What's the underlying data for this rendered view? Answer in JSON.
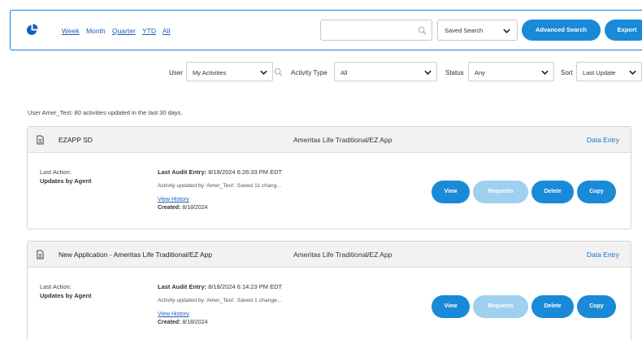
{
  "toolbar": {
    "periods": [
      "Week",
      "Month",
      "Quarter",
      "YTD",
      "All"
    ],
    "search_placeholder": "",
    "saved_search": "Saved Search",
    "advanced_search": "Advanced Search",
    "export": "Export"
  },
  "filters": {
    "user_label": "User",
    "user_value": "My Activities",
    "activity_type_label": "Activity Type",
    "activity_type_value": "All",
    "status_label": "Status",
    "status_value": "Any",
    "sort_label": "Sort",
    "sort_value": "Last Update"
  },
  "summary": "User Amer_Test: 80 activities updated in the last 30 days.",
  "cards": [
    {
      "title": "EZAPP SD",
      "product": "Ameritas Life Traditional/EZ App",
      "entry_link": "Data Entry",
      "last_action_label": "Last Action:",
      "last_action_value": "Updates by Agent",
      "audit_label": "Last Audit Entry:",
      "audit_value": "8/18/2024 6:26:33 PM EDT",
      "activity_text": "Activity updated by 'Amer_Test'. Saved 11 chang...",
      "history_link": "View History",
      "created_label": "Created:",
      "created_value": "8/18/2024",
      "buttons": [
        "View",
        "Requests",
        "Delete",
        "Copy"
      ]
    },
    {
      "title": "New Application - Ameritas Life Traditional/EZ App",
      "product": "Ameritas Life Traditional/EZ App",
      "entry_link": "Data Entry",
      "last_action_label": "Last Action:",
      "last_action_value": "Updates by Agent",
      "audit_label": "Last Audit Entry:",
      "audit_value": "8/18/2024 6:14:23 PM EDT",
      "activity_text": "Activity updated by 'Amer_Test'. Saved 1 change...",
      "history_link": "View History",
      "created_label": "Created:",
      "created_value": "8/18/2024",
      "buttons": [
        "View",
        "Requests",
        "Delete",
        "Copy"
      ]
    }
  ],
  "colors": {
    "accent": "#1a8ad8",
    "accent_disabled": "#9fd0f0",
    "link": "#1a5fbf",
    "border_accent": "#1e7fd6"
  },
  "icons": {
    "chart": "pie-chart-icon",
    "search": "magnifier-icon",
    "dropdown": "chevron-down-icon",
    "document": "document-icon"
  }
}
